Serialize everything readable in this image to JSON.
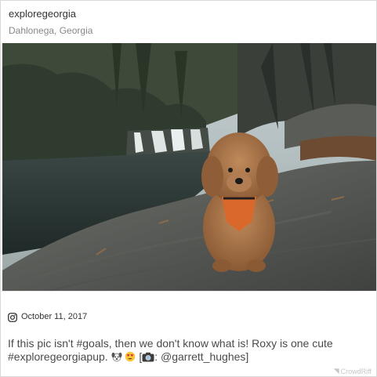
{
  "post": {
    "username": "exploregeorgia",
    "location": "Dahlonega, Georgia",
    "date": "October 11, 2017",
    "caption_text": "If this pic isn't #goals, then we don't know what is! Roxy is one cute #exploregeorgiapup.",
    "caption_credit_prefix": "[",
    "caption_credit_suffix": ": @garrett_hughes]",
    "emoji_icons": [
      "dog-face-icon",
      "heart-eyes-icon",
      "camera-icon"
    ]
  },
  "footer": {
    "brand": "CrowdRiff"
  },
  "icons": {
    "instagram": "instagram-icon"
  }
}
